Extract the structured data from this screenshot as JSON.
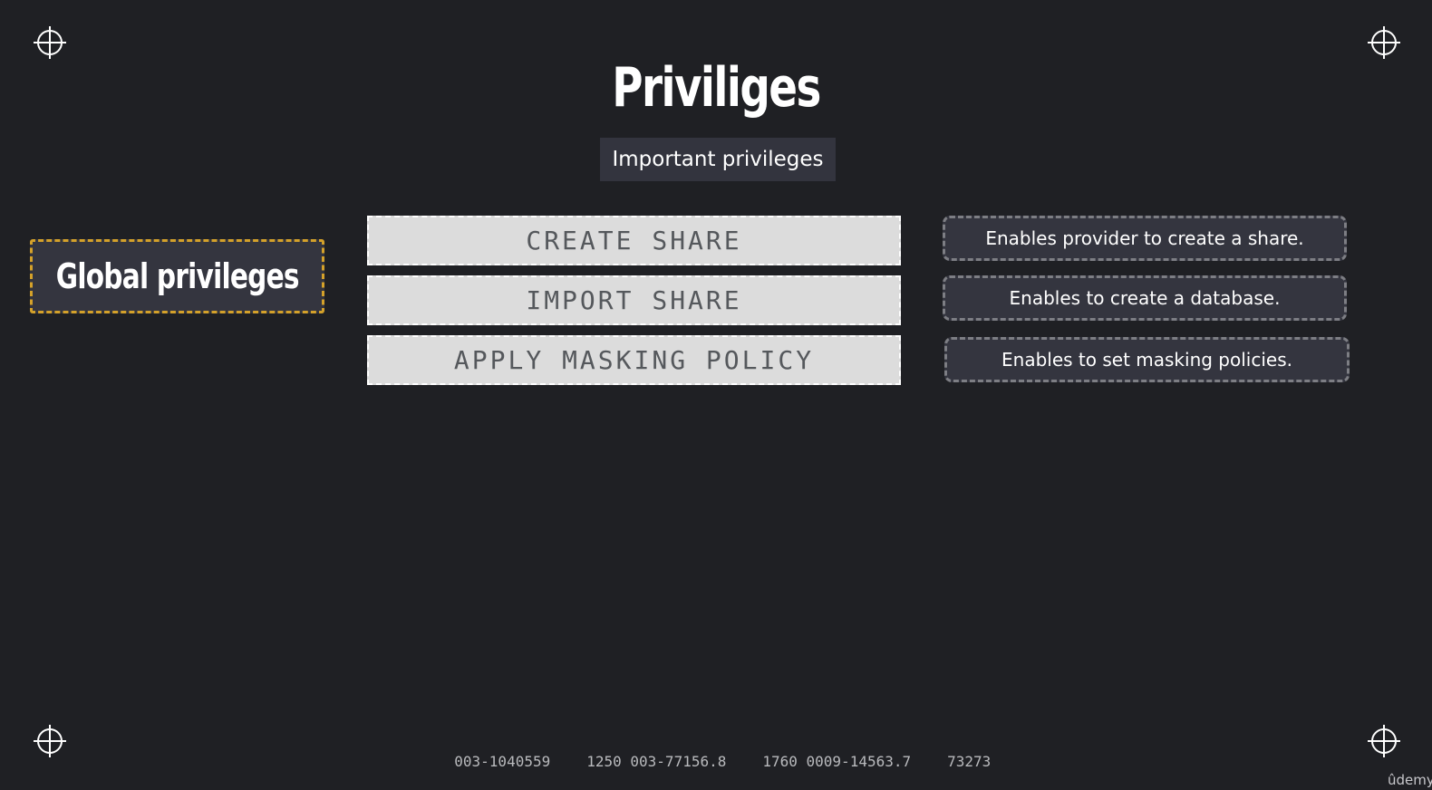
{
  "title": "Priviliges",
  "subtitle": "Important privileges",
  "category": "Global privileges",
  "privileges": [
    {
      "name": "CREATE SHARE",
      "description": "Enables provider to create a share."
    },
    {
      "name": "IMPORT SHARE",
      "description": "Enables to create a database."
    },
    {
      "name": "APPLY MASKING POLICY",
      "description": "Enables to set masking policies."
    }
  ],
  "footer_codes": [
    "003-1040559",
    "1250 003-77156.8",
    "1760 0009-14563.7",
    "73273"
  ],
  "watermark": "ûdemy",
  "colors": {
    "background": "#1f2024",
    "accent_border": "#d4a12a",
    "box_fill": "#34353f",
    "privilege_fill": "#dcdcdc"
  }
}
